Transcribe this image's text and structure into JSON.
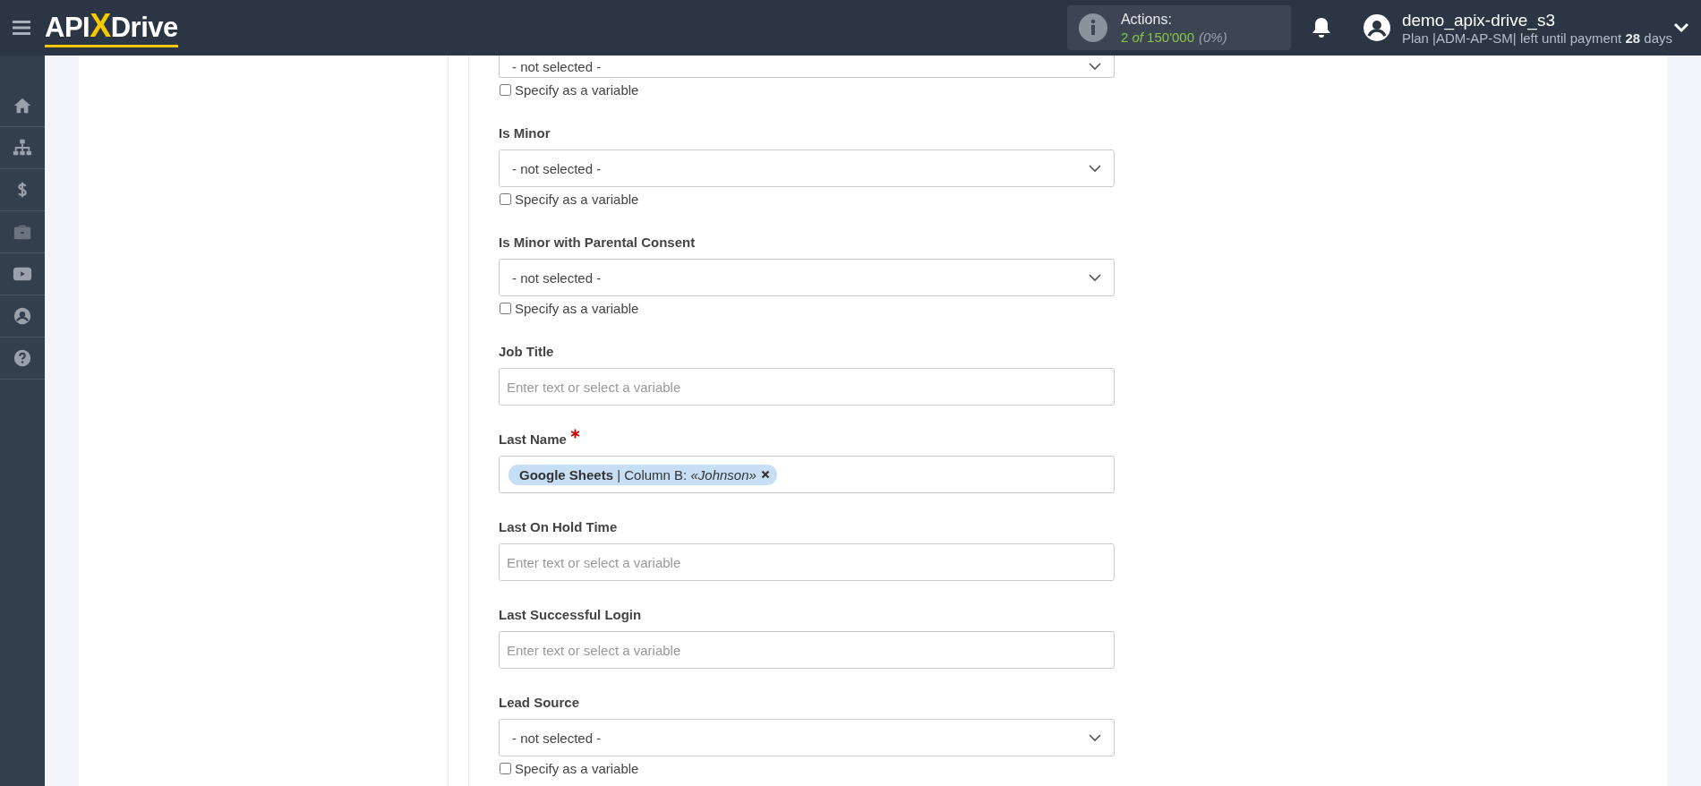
{
  "header": {
    "logo": [
      "API",
      "X",
      "Drive"
    ],
    "actions": {
      "label": "Actions:",
      "usage": "2 *of* 150'000",
      "percent": "(0%)"
    },
    "user": {
      "name": "demo_apix-drive_s3",
      "plan": "Plan |ADM-AP-SM| left until payment **28** days"
    }
  },
  "fields": [
    {
      "kind": "select",
      "required": false,
      "value": "- not selected -",
      "variable": {
        "label": "Specify as a variable",
        "checked": false
      }
    },
    {
      "kind": "select",
      "label": "Is Minor",
      "required": false,
      "value": "- not selected -",
      "variable": {
        "label": "Specify as a variable",
        "checked": false
      }
    },
    {
      "kind": "select",
      "label": "Is Minor with Parental Consent",
      "required": false,
      "value": "- not selected -",
      "variable": {
        "label": "Specify as a variable",
        "checked": false
      }
    },
    {
      "kind": "text",
      "label": "Job Title",
      "required": false,
      "placeholder": "Enter text or select a variable"
    },
    {
      "kind": "tags",
      "label": "Last Name",
      "required": true,
      "tags": [
        "**Google Sheets** | Column B: *«Johnson»*"
      ]
    },
    {
      "kind": "text",
      "label": "Last On Hold Time",
      "required": false,
      "placeholder": "Enter text or select a variable"
    },
    {
      "kind": "text",
      "label": "Last Successful Login",
      "required": false,
      "placeholder": "Enter text or select a variable"
    },
    {
      "kind": "select",
      "label": "Lead Source",
      "required": false,
      "value": "- not selected -",
      "variable": {
        "label": "Specify as a variable",
        "checked": false
      }
    }
  ]
}
